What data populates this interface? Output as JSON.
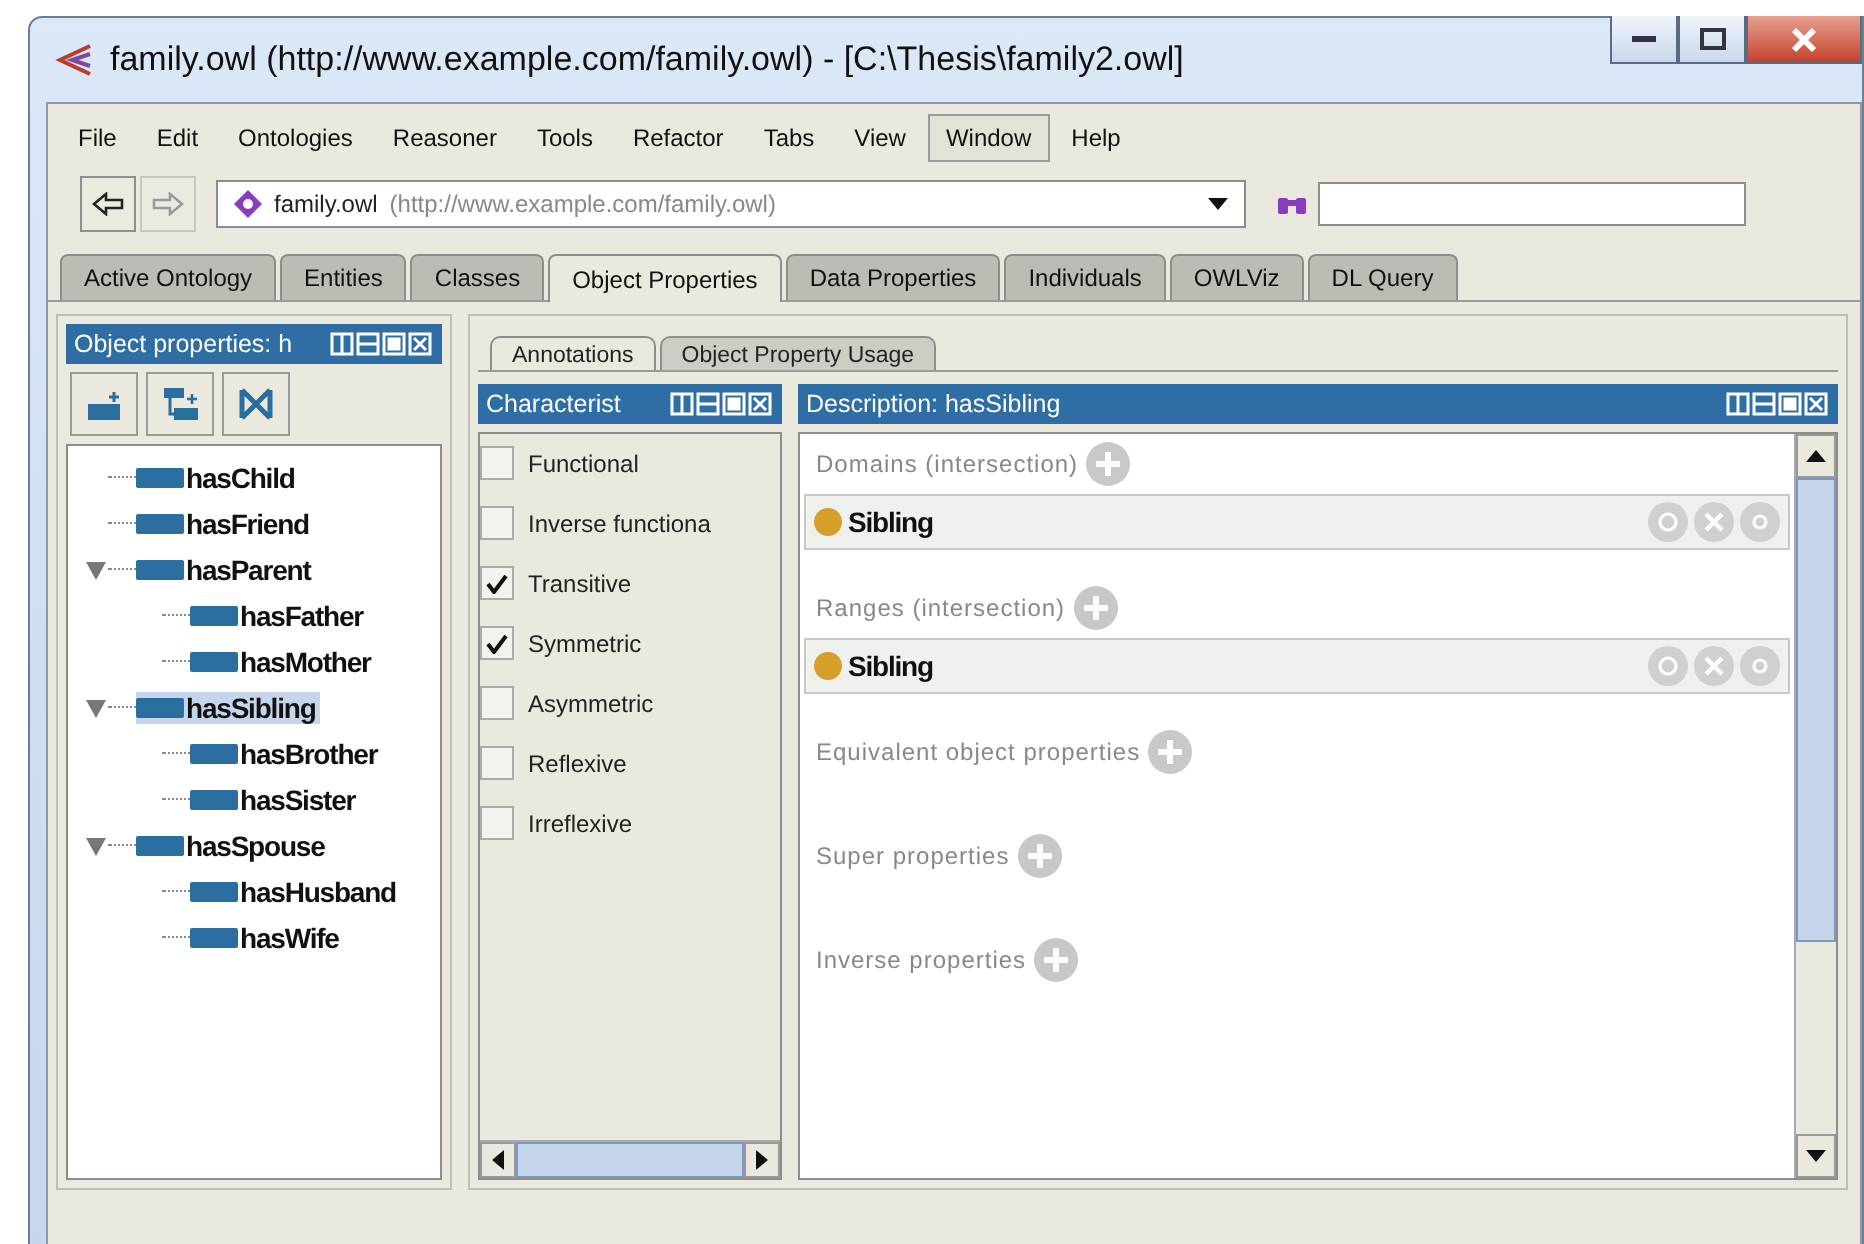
{
  "window": {
    "title": "family.owl (http://www.example.com/family.owl) - [C:\\Thesis\\family2.owl]"
  },
  "menu": [
    {
      "label": "File",
      "selected": false
    },
    {
      "label": "Edit",
      "selected": false
    },
    {
      "label": "Ontologies",
      "selected": false
    },
    {
      "label": "Reasoner",
      "selected": false
    },
    {
      "label": "Tools",
      "selected": false
    },
    {
      "label": "Refactor",
      "selected": false
    },
    {
      "label": "Tabs",
      "selected": false
    },
    {
      "label": "View",
      "selected": false
    },
    {
      "label": "Window",
      "selected": true
    },
    {
      "label": "Help",
      "selected": false
    }
  ],
  "toolbar": {
    "ontology_name": "family.owl",
    "ontology_iri": "(http://www.example.com/family.owl)"
  },
  "tabs": [
    {
      "label": "Active Ontology",
      "selected": false
    },
    {
      "label": "Entities",
      "selected": false
    },
    {
      "label": "Classes",
      "selected": false
    },
    {
      "label": "Object Properties",
      "selected": true
    },
    {
      "label": "Data Properties",
      "selected": false
    },
    {
      "label": "Individuals",
      "selected": false
    },
    {
      "label": "OWLViz",
      "selected": false
    },
    {
      "label": "DL Query",
      "selected": false
    }
  ],
  "hierarchy": {
    "title": "Object properties: h",
    "items": [
      {
        "label": "hasChild",
        "expanded": false,
        "selected": false
      },
      {
        "label": "hasFriend",
        "expanded": false,
        "selected": false
      },
      {
        "label": "hasParent",
        "expanded": true,
        "selected": false,
        "children": [
          {
            "label": "hasFather",
            "expanded": false,
            "selected": false
          },
          {
            "label": "hasMother",
            "expanded": false,
            "selected": false
          }
        ]
      },
      {
        "label": "hasSibling",
        "expanded": true,
        "selected": true,
        "children": [
          {
            "label": "hasBrother",
            "expanded": false,
            "selected": false
          },
          {
            "label": "hasSister",
            "expanded": false,
            "selected": false
          }
        ]
      },
      {
        "label": "hasSpouse",
        "expanded": true,
        "selected": false,
        "children": [
          {
            "label": "hasHusband",
            "expanded": false,
            "selected": false
          },
          {
            "label": "hasWife",
            "expanded": false,
            "selected": false
          }
        ]
      }
    ]
  },
  "subtabs": [
    {
      "label": "Annotations",
      "selected": true
    },
    {
      "label": "Object Property Usage",
      "selected": false
    }
  ],
  "characteristics": {
    "title": "Characterist",
    "items": [
      {
        "label": "Functional",
        "checked": false
      },
      {
        "label": "Inverse functiona",
        "checked": false
      },
      {
        "label": "Transitive",
        "checked": true
      },
      {
        "label": "Symmetric",
        "checked": true
      },
      {
        "label": "Asymmetric",
        "checked": false
      },
      {
        "label": "Reflexive",
        "checked": false
      },
      {
        "label": "Irreflexive",
        "checked": false
      }
    ]
  },
  "description": {
    "title": "Description: hasSibling",
    "sections": [
      {
        "label": "Domains (intersection)",
        "items": [
          {
            "label": "Sibling",
            "color": "#d4a02a"
          }
        ]
      },
      {
        "label": "Ranges (intersection)",
        "items": [
          {
            "label": "Sibling",
            "color": "#d4a02a"
          }
        ]
      },
      {
        "label": "Equivalent object properties"
      },
      {
        "label": "Super properties"
      },
      {
        "label": "Inverse properties"
      }
    ]
  }
}
